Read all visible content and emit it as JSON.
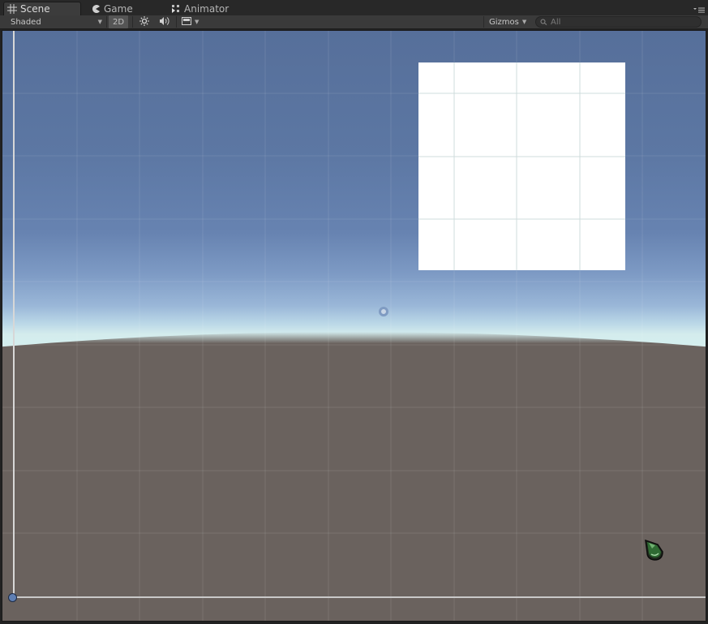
{
  "tabs": [
    {
      "label": "Scene",
      "icon": "grid-icon",
      "active": true
    },
    {
      "label": "Game",
      "icon": "pacman-icon",
      "active": false
    },
    {
      "label": "Animator",
      "icon": "animator-icon",
      "active": false
    }
  ],
  "toolbar": {
    "shading_mode": "Shaded",
    "mode_2d": "2D",
    "lighting_icon": "sun-icon",
    "audio_icon": "speaker-icon",
    "effects_icon": "image-icon",
    "gizmos_label": "Gizmos",
    "search_placeholder": "All"
  },
  "colors": {
    "sky_top": "#566f9a",
    "horizon": "#d4eeee",
    "ground": "#6a625e",
    "canvas": "#ffffff"
  }
}
